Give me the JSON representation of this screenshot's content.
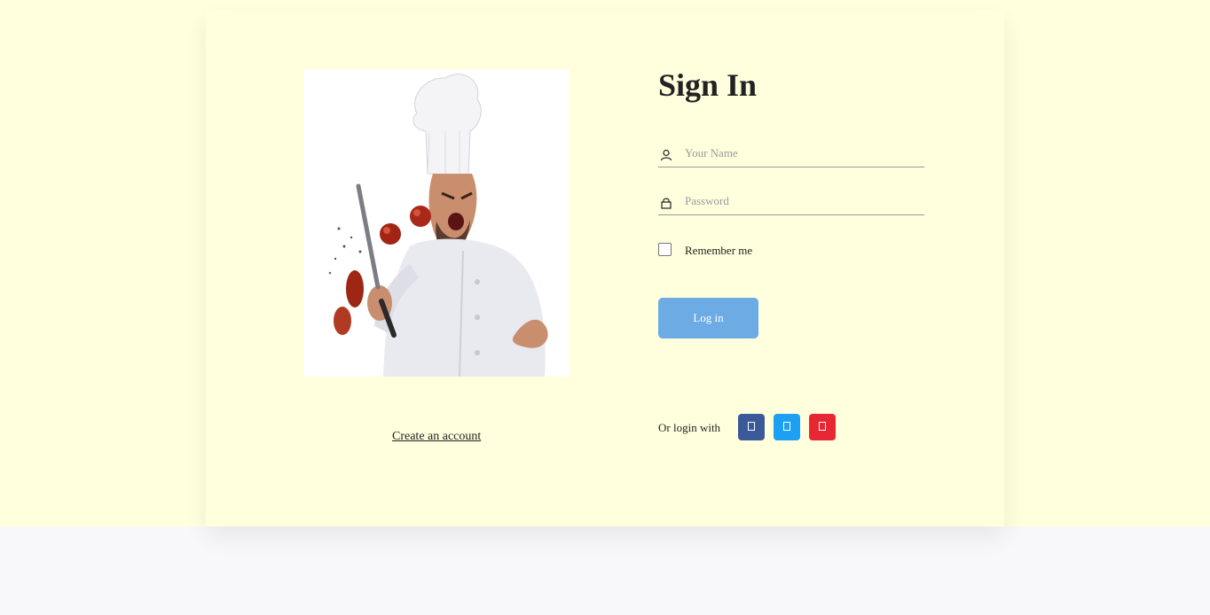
{
  "left": {
    "create_account_label": "Create an account"
  },
  "form": {
    "title": "Sign In",
    "name_placeholder": "Your Name",
    "password_placeholder": "Password",
    "remember_label": "Remember me",
    "login_label": "Log in"
  },
  "social": {
    "label": "Or login with",
    "buttons": [
      {
        "icon": "facebook-icon",
        "color": "#3b5998"
      },
      {
        "icon": "twitter-icon",
        "color": "#1da0f2"
      },
      {
        "icon": "google-icon",
        "color": "#e72734"
      }
    ]
  },
  "colors": {
    "background": "#ffffde",
    "page_bottom": "#f8f8fa",
    "login_button": "#6dabe4",
    "text": "#222222"
  }
}
